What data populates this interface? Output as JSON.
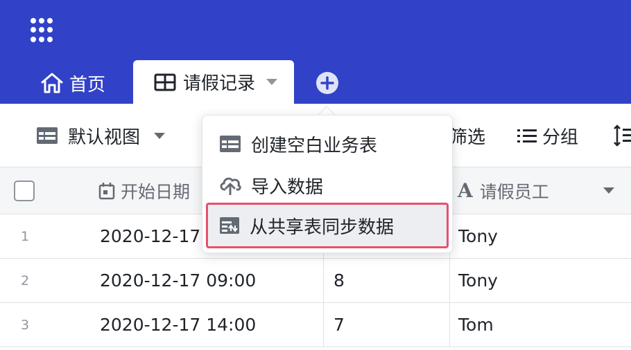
{
  "header": {
    "tabs": [
      {
        "label": "首页",
        "icon": "home-icon"
      },
      {
        "label": "请假记录",
        "icon": "grid-table-icon",
        "active": true
      }
    ],
    "add_tab_icon": "plus-circle-icon",
    "apps_icon": "apps-grid-icon",
    "bar_color": "#3142c8"
  },
  "toolbar": {
    "view_label": "默认视图",
    "filter_label": "筛选",
    "group_label": "分组"
  },
  "table": {
    "columns": [
      {
        "label": "开始日期",
        "icon": "calendar-icon"
      },
      {
        "label": "请假员工",
        "icon": "text-a-icon",
        "icon_text": "A"
      }
    ],
    "rows": [
      {
        "num": "1",
        "date": "2020-12-17",
        "value": "",
        "employee": "Tony"
      },
      {
        "num": "2",
        "date": "2020-12-17 09:00",
        "value": "8",
        "employee": "Tony"
      },
      {
        "num": "3",
        "date": "2020-12-17 14:00",
        "value": "7",
        "employee": "Tom"
      }
    ]
  },
  "menu": {
    "items": [
      {
        "label": "创建空白业务表",
        "icon": "table-icon"
      },
      {
        "label": "导入数据",
        "icon": "cloud-upload-icon"
      },
      {
        "label": "从共享表同步数据",
        "icon": "sync-table-icon",
        "highlighted": true
      }
    ],
    "highlight_color": "#e8506b"
  }
}
